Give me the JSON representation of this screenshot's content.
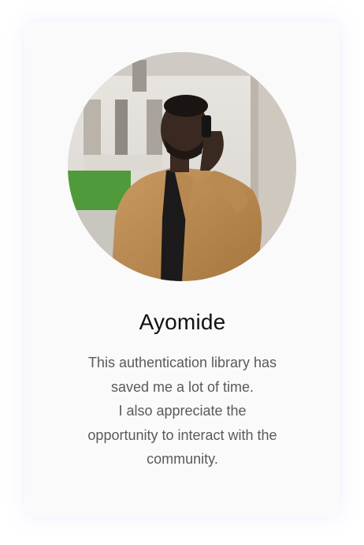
{
  "testimonial": {
    "name": "Ayomide",
    "quote_lines": [
      "This authentication library has",
      "saved me a lot of time.",
      "I also appreciate the",
      "opportunity to interact with the",
      "community."
    ],
    "avatar_icon": "person-photo-avatar"
  },
  "colors": {
    "card_background": "#fafafb",
    "name_text": "#111111",
    "quote_text": "#5a5a5a"
  }
}
